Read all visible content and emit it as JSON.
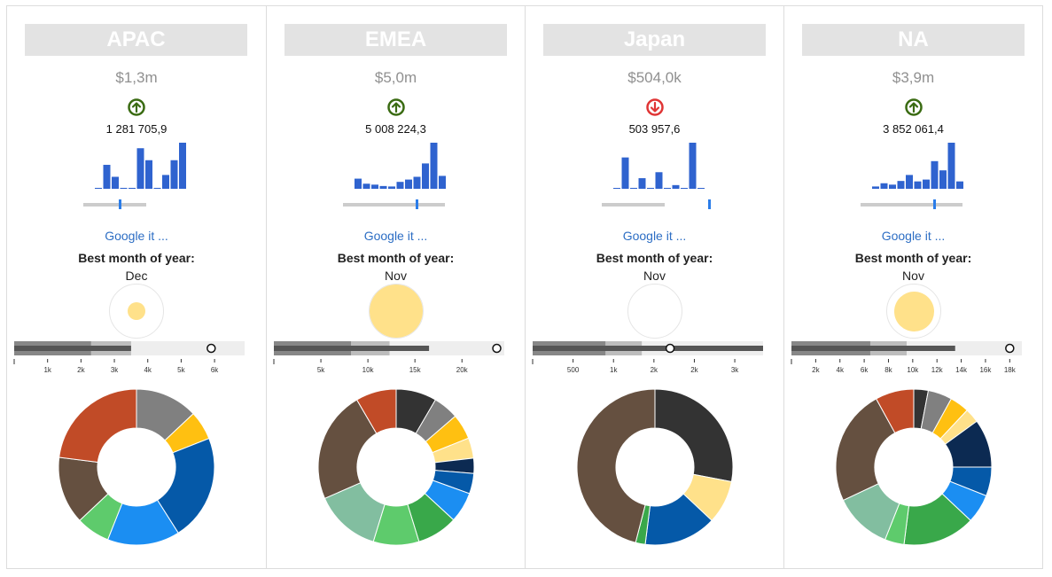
{
  "colors": {
    "panel_title_bg": "#e3e3e3",
    "up_arrow": "#3a6b12",
    "down_arrow": "#e03535",
    "spark_bar": "#2f63cf",
    "link": "#2d6ec4",
    "bubble": "#ffe18a",
    "bullet_light": "#eeeeee",
    "bullet_mid": "#bdbdbd",
    "bullet_dark": "#878787",
    "bullet_measure": "#555555"
  },
  "common": {
    "google_link": "Google it ...",
    "best_month_label": "Best month of year:"
  },
  "panels": [
    {
      "region": "APAC",
      "total": "$1,3m",
      "trend": "up",
      "trend_icon": "arrow-up-circle-icon",
      "exact_value": "1 281 705,9",
      "sparkline": [
        0.02,
        0.52,
        0.26,
        0.02,
        0.02,
        0.88,
        0.62,
        0.02,
        0.3,
        0.62,
        1.0
      ],
      "range": {
        "start": 0.0,
        "end": 0.62,
        "position": 0.36
      },
      "best_month": "Dec",
      "best_month_share": 0.2,
      "bullet": {
        "ticks": [
          "1k",
          "2k",
          "3k",
          "4k",
          "5k",
          "6k"
        ],
        "tick_values": [
          1000,
          2000,
          3000,
          4000,
          5000,
          6000
        ],
        "max": 6900,
        "ranges": [
          2300,
          3500,
          6900
        ],
        "measure": 3500,
        "marker": 5900
      },
      "donut": [
        {
          "color": "#808080",
          "value": 13
        },
        {
          "color": "#ffc011",
          "value": 6
        },
        {
          "color": "#0559a8",
          "value": 22
        },
        {
          "color": "#1b8ef2",
          "value": 15
        },
        {
          "color": "#5ecb6c",
          "value": 7
        },
        {
          "color": "#655040",
          "value": 14
        },
        {
          "color": "#c14b27",
          "value": 23
        }
      ]
    },
    {
      "region": "EMEA",
      "total": "$5,0m",
      "trend": "up",
      "trend_icon": "arrow-up-circle-icon",
      "exact_value": "5 008 224,3",
      "sparkline": [
        0.22,
        0.11,
        0.09,
        0.06,
        0.05,
        0.15,
        0.2,
        0.26,
        0.55,
        1.0,
        0.28
      ],
      "range": {
        "start": 0.0,
        "end": 1.0,
        "position": 0.72
      },
      "best_month": "Nov",
      "best_month_share": 1.0,
      "bullet": {
        "ticks": [
          "5k",
          "10k",
          "15k",
          "20k"
        ],
        "tick_values": [
          5000,
          10000,
          15000,
          20000
        ],
        "max": 24500,
        "ranges": [
          8200,
          12300,
          24500
        ],
        "measure": 16500,
        "marker": 23700
      },
      "donut": [
        {
          "color": "#333333",
          "value": 8
        },
        {
          "color": "#808080",
          "value": 5
        },
        {
          "color": "#ffc011",
          "value": 5
        },
        {
          "color": "#ffe18a",
          "value": 4
        },
        {
          "color": "#0c2a52",
          "value": 3
        },
        {
          "color": "#0559a8",
          "value": 4
        },
        {
          "color": "#1b8ef2",
          "value": 6
        },
        {
          "color": "#39a84a",
          "value": 8
        },
        {
          "color": "#5ecb6c",
          "value": 9
        },
        {
          "color": "#82bea0",
          "value": 13
        },
        {
          "color": "#655040",
          "value": 22
        },
        {
          "color": "#c14b27",
          "value": 8
        }
      ]
    },
    {
      "region": "Japan",
      "total": "$504,0k",
      "trend": "down",
      "trend_icon": "arrow-down-circle-icon",
      "exact_value": "503 957,6",
      "sparkline": [
        0.0,
        0.68,
        0.02,
        0.23,
        0.02,
        0.36,
        0.02,
        0.08,
        0.0,
        1.0,
        0.0
      ],
      "range": {
        "start": 0.0,
        "end": 0.62,
        "position": 1.05
      },
      "best_month": "Nov",
      "best_month_share": 0.0,
      "bullet": {
        "ticks": [
          "500",
          "1k",
          "2k",
          "2k",
          "3k"
        ],
        "tick_values": [
          500,
          1000,
          1500,
          2000,
          2500
        ],
        "max": 2850,
        "ranges": [
          900,
          1350,
          2850
        ],
        "measure": 2850,
        "marker": 1700
      },
      "donut": [
        {
          "color": "#333333",
          "value": 28
        },
        {
          "color": "#ffe18a",
          "value": 9
        },
        {
          "color": "#0559a8",
          "value": 15
        },
        {
          "color": "#39a84a",
          "value": 2
        },
        {
          "color": "#655040",
          "value": 46
        }
      ]
    },
    {
      "region": "NA",
      "total": "$3,9m",
      "trend": "up",
      "trend_icon": "arrow-up-circle-icon",
      "exact_value": "3 852 061,4",
      "sparkline": [
        0.05,
        0.12,
        0.09,
        0.17,
        0.3,
        0.16,
        0.2,
        0.6,
        0.4,
        1.0,
        0.16
      ],
      "range": {
        "start": 0.0,
        "end": 1.0,
        "position": 0.72
      },
      "best_month": "Nov",
      "best_month_share": 0.7,
      "bullet": {
        "ticks": [
          "2k",
          "4k",
          "6k",
          "8k",
          "10k",
          "12k",
          "14k",
          "16k",
          "18k"
        ],
        "tick_values": [
          2000,
          4000,
          6000,
          8000,
          10000,
          12000,
          14000,
          16000,
          18000
        ],
        "max": 19000,
        "ranges": [
          6500,
          9500,
          19000
        ],
        "measure": 13500,
        "marker": 18000
      },
      "donut": [
        {
          "color": "#333333",
          "value": 3
        },
        {
          "color": "#808080",
          "value": 5
        },
        {
          "color": "#ffc011",
          "value": 4
        },
        {
          "color": "#ffe18a",
          "value": 3
        },
        {
          "color": "#0c2a52",
          "value": 10
        },
        {
          "color": "#0559a8",
          "value": 6
        },
        {
          "color": "#1b8ef2",
          "value": 6
        },
        {
          "color": "#39a84a",
          "value": 15
        },
        {
          "color": "#5ecb6c",
          "value": 4
        },
        {
          "color": "#82bea0",
          "value": 12
        },
        {
          "color": "#655040",
          "value": 24
        },
        {
          "color": "#c14b27",
          "value": 8
        }
      ]
    }
  ]
}
